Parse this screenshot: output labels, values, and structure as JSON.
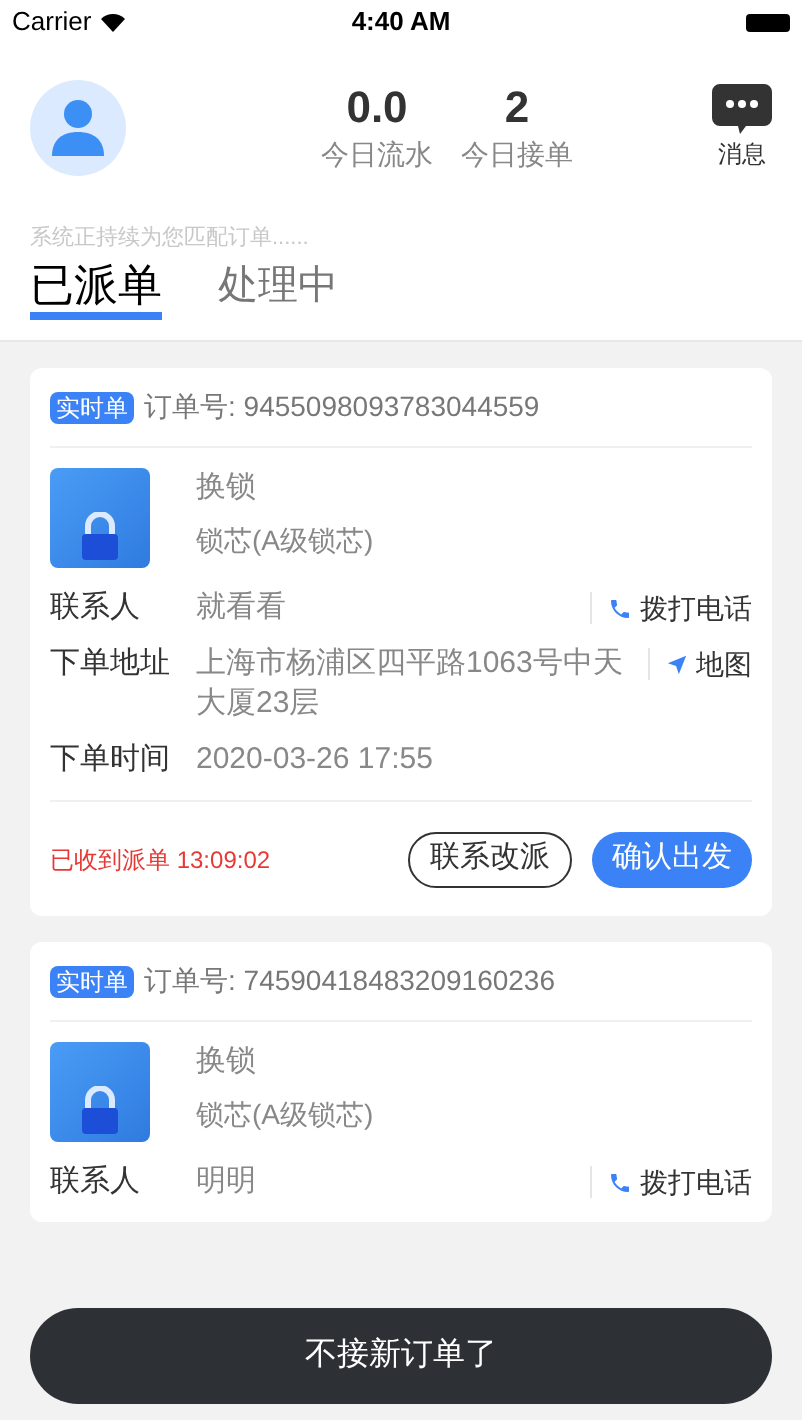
{
  "status_bar": {
    "carrier": "Carrier",
    "time": "4:40 AM"
  },
  "header": {
    "stats": [
      {
        "value": "0.0",
        "label": "今日流水"
      },
      {
        "value": "2",
        "label": "今日接单"
      }
    ],
    "messages_label": "消息"
  },
  "notice": "系统正持续为您匹配订单......",
  "tabs": [
    {
      "label": "已派单",
      "selected": true
    },
    {
      "label": "处理中",
      "selected": false
    }
  ],
  "orders": [
    {
      "tag": "实时单",
      "order_no": "订单号: 9455098093783044559",
      "service": "换锁",
      "item": "锁芯(A级锁芯)",
      "fields": [
        {
          "label": "联系人",
          "value": "就看看",
          "action": {
            "kind": "call",
            "label": "拨打电话"
          }
        },
        {
          "label": "下单地址",
          "value": "上海市杨浦区四平路1063号中天大厦23层",
          "action": {
            "kind": "map",
            "label": "地图"
          }
        },
        {
          "label": "下单时间",
          "value": "2020-03-26 17:55"
        }
      ],
      "footer": {
        "status": "已收到派单 13:09:02",
        "buttons": [
          {
            "label": "联系改派",
            "kind": "outline"
          },
          {
            "label": "确认出发",
            "kind": "primary"
          }
        ]
      }
    },
    {
      "tag": "实时单",
      "order_no": "订单号: 74590418483209160236",
      "service": "换锁",
      "item": "锁芯(A级锁芯)",
      "fields": [
        {
          "label": "联系人",
          "value": "明明",
          "action": {
            "kind": "call",
            "label": "拨打电话"
          }
        }
      ]
    }
  ],
  "bottom_bar": {
    "label": "不接新订单了"
  }
}
